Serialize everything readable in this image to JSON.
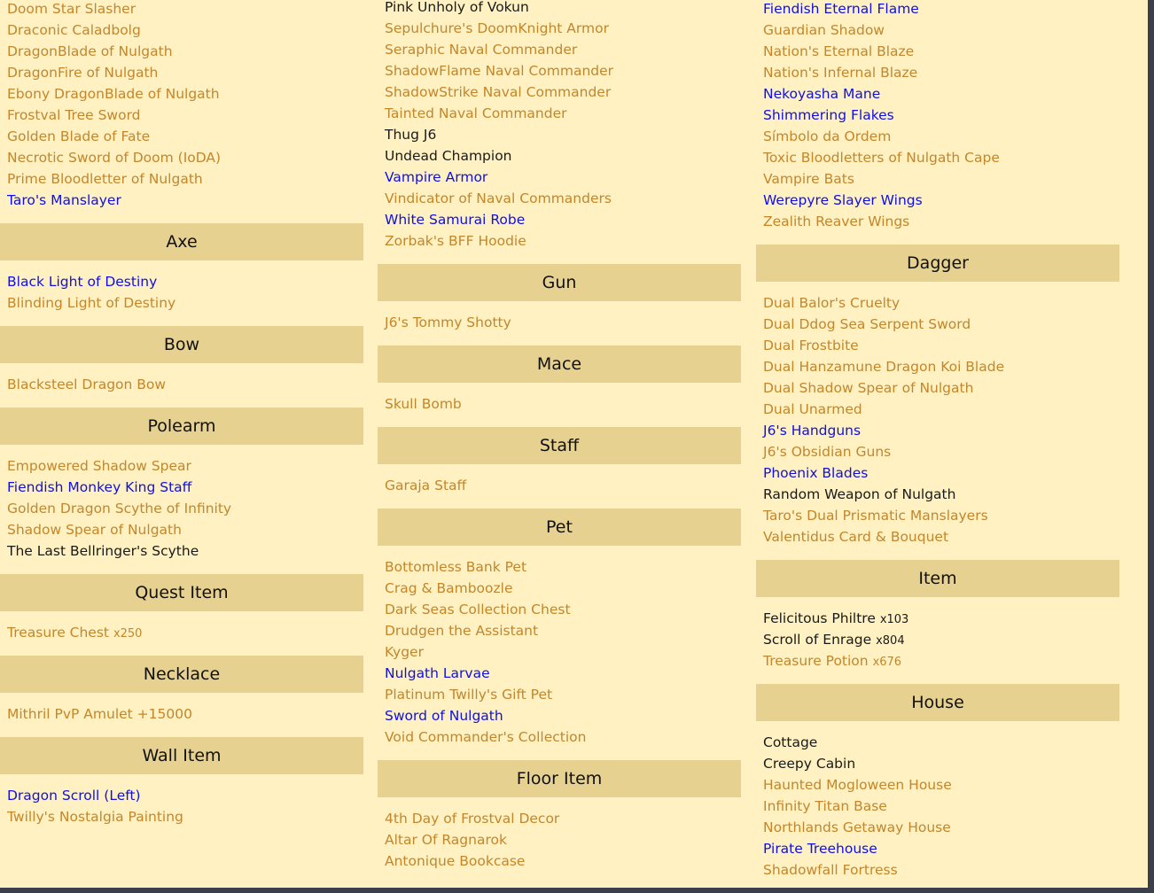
{
  "colors": {
    "orange": "#c4862a",
    "blue": "#1010e6",
    "black": "#1a1a1a",
    "header_bg": "#e6d191",
    "page_bg": "#fff1c2"
  },
  "columns": [
    {
      "sections": [
        {
          "title": "",
          "items": [
            {
              "name": "Doom Star Slasher",
              "color": "orange"
            },
            {
              "name": "Draconic Caladbolg",
              "color": "orange"
            },
            {
              "name": "DragonBlade of Nulgath",
              "color": "orange"
            },
            {
              "name": "DragonFire of Nulgath",
              "color": "orange"
            },
            {
              "name": "Ebony DragonBlade of Nulgath",
              "color": "orange"
            },
            {
              "name": "Frostval Tree Sword",
              "color": "orange"
            },
            {
              "name": "Golden Blade of Fate",
              "color": "orange"
            },
            {
              "name": "Necrotic Sword of Doom (IoDA)",
              "color": "orange"
            },
            {
              "name": "Prime Bloodletter of Nulgath",
              "color": "orange"
            },
            {
              "name": "Taro's Manslayer",
              "color": "blue"
            }
          ]
        },
        {
          "title": "Axe",
          "items": [
            {
              "name": "Black Light of Destiny",
              "color": "blue"
            },
            {
              "name": "Blinding Light of Destiny",
              "color": "orange"
            }
          ]
        },
        {
          "title": "Bow",
          "items": [
            {
              "name": "Blacksteel Dragon Bow",
              "color": "orange"
            }
          ]
        },
        {
          "title": "Polearm",
          "items": [
            {
              "name": "Empowered Shadow Spear",
              "color": "orange"
            },
            {
              "name": "Fiendish Monkey King Staff",
              "color": "blue"
            },
            {
              "name": "Golden Dragon Scythe of Infinity",
              "color": "orange"
            },
            {
              "name": "Shadow Spear of Nulgath",
              "color": "orange"
            },
            {
              "name": "The Last Bellringer's Scythe",
              "color": "black"
            }
          ]
        },
        {
          "title": "Quest Item",
          "items": [
            {
              "name": "Treasure Chest",
              "qty": "x250",
              "color": "orange"
            }
          ]
        },
        {
          "title": "Necklace",
          "items": [
            {
              "name": "Mithril PvP Amulet +15000",
              "color": "orange"
            }
          ]
        },
        {
          "title": "Wall Item",
          "items": [
            {
              "name": "Dragon Scroll (Left)",
              "color": "blue"
            },
            {
              "name": "Twilly's Nostalgia Painting",
              "color": "orange"
            }
          ]
        }
      ]
    },
    {
      "sections": [
        {
          "title": "",
          "items": [
            {
              "name": "Pink Unholy of Vokun",
              "color": "black"
            },
            {
              "name": "Sepulchure's DoomKnight Armor",
              "color": "orange"
            },
            {
              "name": "Seraphic Naval Commander",
              "color": "orange"
            },
            {
              "name": "ShadowFlame Naval Commander",
              "color": "orange"
            },
            {
              "name": "ShadowStrike Naval Commander",
              "color": "orange"
            },
            {
              "name": "Tainted Naval Commander",
              "color": "orange"
            },
            {
              "name": "Thug J6",
              "color": "black"
            },
            {
              "name": "Undead Champion",
              "color": "black"
            },
            {
              "name": "Vampire Armor",
              "color": "blue"
            },
            {
              "name": "Vindicator of Naval Commanders",
              "color": "orange"
            },
            {
              "name": "White Samurai Robe",
              "color": "blue"
            },
            {
              "name": "Zorbak's BFF Hoodie",
              "color": "orange"
            }
          ]
        },
        {
          "title": "Gun",
          "items": [
            {
              "name": "J6's Tommy Shotty",
              "color": "orange"
            }
          ]
        },
        {
          "title": "Mace",
          "items": [
            {
              "name": "Skull Bomb",
              "color": "orange"
            }
          ]
        },
        {
          "title": "Staff",
          "items": [
            {
              "name": "Garaja Staff",
              "color": "orange"
            }
          ]
        },
        {
          "title": "Pet",
          "items": [
            {
              "name": "Bottomless Bank Pet",
              "color": "orange"
            },
            {
              "name": "Crag & Bamboozle",
              "color": "orange"
            },
            {
              "name": "Dark Seas Collection Chest",
              "color": "orange"
            },
            {
              "name": "Drudgen the Assistant",
              "color": "orange"
            },
            {
              "name": "Kyger",
              "color": "orange"
            },
            {
              "name": "Nulgath Larvae",
              "color": "blue"
            },
            {
              "name": "Platinum Twilly's Gift Pet",
              "color": "orange"
            },
            {
              "name": "Sword of Nulgath",
              "color": "blue"
            },
            {
              "name": "Void Commander's Collection",
              "color": "orange"
            }
          ]
        },
        {
          "title": "Floor Item",
          "items": [
            {
              "name": "4th Day of Frostval Decor",
              "color": "orange"
            },
            {
              "name": "Altar Of Ragnarok",
              "color": "orange"
            },
            {
              "name": "Antonique Bookcase",
              "color": "orange"
            }
          ]
        }
      ]
    },
    {
      "sections": [
        {
          "title": "",
          "items": [
            {
              "name": "Fiendish Eternal Flame",
              "color": "blue"
            },
            {
              "name": "Guardian Shadow",
              "color": "orange"
            },
            {
              "name": "Nation's Eternal Blaze",
              "color": "orange"
            },
            {
              "name": "Nation's Infernal Blaze",
              "color": "orange"
            },
            {
              "name": "Nekoyasha Mane",
              "color": "blue"
            },
            {
              "name": "Shimmering Flakes",
              "color": "blue"
            },
            {
              "name": "Símbolo da Ordem",
              "color": "orange"
            },
            {
              "name": "Toxic Bloodletters of Nulgath Cape",
              "color": "orange"
            },
            {
              "name": "Vampire Bats",
              "color": "orange"
            },
            {
              "name": "Werepyre Slayer Wings",
              "color": "blue"
            },
            {
              "name": "Zealith Reaver Wings",
              "color": "orange"
            }
          ]
        },
        {
          "title": "Dagger",
          "items": [
            {
              "name": "Dual Balor's Cruelty",
              "color": "orange"
            },
            {
              "name": "Dual Ddog Sea Serpent Sword",
              "color": "orange"
            },
            {
              "name": "Dual Frostbite",
              "color": "orange"
            },
            {
              "name": "Dual Hanzamune Dragon Koi Blade",
              "color": "orange"
            },
            {
              "name": "Dual Shadow Spear of Nulgath",
              "color": "orange"
            },
            {
              "name": "Dual Unarmed",
              "color": "orange"
            },
            {
              "name": "J6's Handguns",
              "color": "blue"
            },
            {
              "name": "J6's Obsidian Guns",
              "color": "orange"
            },
            {
              "name": "Phoenix Blades",
              "color": "blue"
            },
            {
              "name": "Random Weapon of Nulgath",
              "color": "black"
            },
            {
              "name": "Taro's Dual Prismatic Manslayers",
              "color": "orange"
            },
            {
              "name": "Valentidus Card & Bouquet",
              "color": "orange"
            }
          ]
        },
        {
          "title": "Item",
          "items": [
            {
              "name": "Felicitous Philtre",
              "qty": "x103",
              "color": "black"
            },
            {
              "name": "Scroll of Enrage",
              "qty": "x804",
              "color": "black"
            },
            {
              "name": "Treasure Potion",
              "qty": "x676",
              "color": "orange"
            }
          ]
        },
        {
          "title": "House",
          "items": [
            {
              "name": "Cottage",
              "color": "black"
            },
            {
              "name": "Creepy Cabin",
              "color": "black"
            },
            {
              "name": "Haunted Mogloween House",
              "color": "orange"
            },
            {
              "name": "Infinity Titan Base",
              "color": "orange"
            },
            {
              "name": "Northlands Getaway House",
              "color": "orange"
            },
            {
              "name": "Pirate Treehouse",
              "color": "blue"
            },
            {
              "name": "Shadowfall Fortress",
              "color": "orange"
            }
          ]
        }
      ]
    }
  ]
}
